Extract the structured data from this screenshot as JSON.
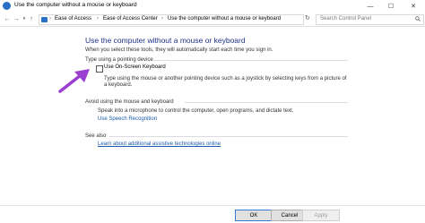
{
  "window": {
    "title": "Use the computer without a mouse or keyboard",
    "min_glyph": "—",
    "max_glyph": "☐",
    "close_glyph": "✕"
  },
  "nav": {
    "back": "←",
    "forward": "→",
    "recent": "▾",
    "up": "↑",
    "refresh": "↻"
  },
  "breadcrumb": {
    "items": [
      "Ease of Access",
      "Ease of Access Center",
      "Use the computer without a mouse or keyboard"
    ],
    "separator": "›"
  },
  "search": {
    "placeholder": "Search Control Panel"
  },
  "main": {
    "heading": "Use the computer without a mouse or keyboard",
    "intro": "When you select these tools, they will automatically start each time you sign in.",
    "pointing_section": "Type using a pointing device",
    "osk_label": "Use On-Screen Keyboard",
    "osk_checked": false,
    "osk_desc_1": "Type using the mouse or another pointing device such as a joystick by selecting keys from a picture of",
    "osk_desc_2": "a keyboard.",
    "avoid_section": "Avoid using the mouse and keyboard",
    "speech_desc": "Speak into a microphone to control the computer, open programs, and dictate text.",
    "speech_link": "Use Speech Recognition",
    "see_also": "See also",
    "learn_link": "Learn about additional assistive technologies online"
  },
  "buttons": {
    "ok": "OK",
    "cancel": "Cancel",
    "apply": "Apply"
  },
  "colors": {
    "heading": "#1e3287",
    "link": "#1a5aa8",
    "arrow": "#9b3fd1"
  }
}
